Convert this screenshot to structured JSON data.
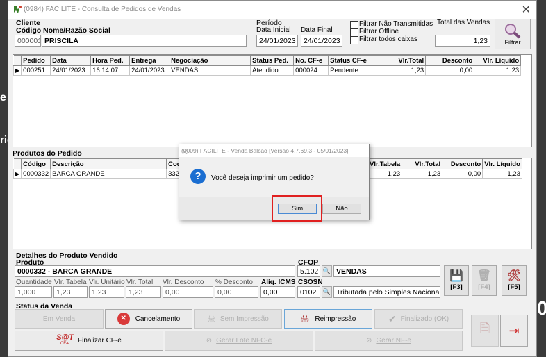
{
  "window": {
    "title": "(0984) FACILITE - Consulta de Pedidos de Vendas"
  },
  "background_fragments": [
    "e /",
    "ric",
    "0"
  ],
  "cliente": {
    "section_label": "Cliente",
    "codigo_label": "Código",
    "nome_label": "Nome/Razão Social",
    "codigo": "000001",
    "nome": "PRISCILA"
  },
  "periodo": {
    "section_label": "Período",
    "inicial_label": "Data Inicial",
    "final_label": "Data Final",
    "inicial": "24/01/2023",
    "final": "24/01/2023"
  },
  "filters": [
    {
      "label": "Filtrar Não Transmitidas",
      "checked": false
    },
    {
      "label": "Filtrar Offline",
      "checked": false
    },
    {
      "label": "Filtrar todos caixas",
      "checked": false
    }
  ],
  "total": {
    "label": "Total das Vendas",
    "value": "1,23"
  },
  "filtrar_button": {
    "label": "Filtrar",
    "icon": "magnifier-icon"
  },
  "orders": {
    "columns": [
      "Pedido",
      "Data",
      "Hora Ped.",
      "Entrega",
      "Negociação",
      "Status Ped.",
      "No. CF-e",
      "Status CF-e",
      "Vlr.Total",
      "Desconto",
      "Vlr. Líquido"
    ],
    "rows": [
      [
        "000251",
        "24/01/2023",
        "16:14:07",
        "24/01/2023",
        "VENDAS",
        "Atendido",
        "000024",
        "Pendente",
        "1,23",
        "0,00",
        "1,23"
      ]
    ]
  },
  "products": {
    "section_label": "Produtos do Pedido",
    "left_columns": [
      "Código",
      "Descrição",
      "Cod. E"
    ],
    "right_columns": [
      "Vlr.Tabela",
      "Vlr.Total",
      "Desconto",
      "Vlr. Líquido"
    ],
    "rows": [
      {
        "left": [
          "0000332",
          "BARCA GRANDE",
          "332"
        ],
        "right": [
          "1,23",
          "1,23",
          "0,00",
          "1,23"
        ]
      }
    ]
  },
  "detalhes": {
    "section_label": "Detalhes do Produto Vendido",
    "produto_label": "Produto",
    "produto": "0000332 - BARCA GRANDE",
    "cfop_label": "CFOP",
    "cfop": "5.102",
    "cfop_desc": "VENDAS",
    "csosn_label": "CSOSN",
    "csosn": "0102",
    "csosn_desc": "Tributada pelo Simples Nacional se",
    "quantidade_label": "Quantidade",
    "vlr_tabela_label": "Vlr. Tabela",
    "vlr_unitario_label": "Vlr. Unitário",
    "vlr_total_label": "Vlr. Total",
    "vlr_desconto_label": "Vlr. Desconto",
    "pct_desconto_label": "% Desconto",
    "aliq_icms_label": "Alíq. ICMS",
    "quantidade": "1,000",
    "vlr_tabela": "1,23",
    "vlr_unitario": "1,23",
    "vlr_total": "1,23",
    "vlr_desconto": "0,00",
    "pct_desconto": "0,00",
    "aliq_icms": "0,00"
  },
  "side_buttons": [
    {
      "label": "[F3]",
      "icon": "floppy-disk-icon",
      "enabled": true
    },
    {
      "label": "[F4]",
      "icon": "trash-icon",
      "enabled": false
    },
    {
      "label": "[F5]",
      "icon": "tools-icon",
      "enabled": true
    }
  ],
  "status": {
    "section_label": "Status da Venda",
    "em_venda": "Em Venda",
    "cancelamento": "Cancelamento",
    "sem_impressao": "Sem Impressão",
    "reimpressao": "Reimpressão",
    "finalizado": "Finalizado (OK)",
    "finalizar_cfe": "Finalizar CF-e",
    "finalizar_logo": "S@T",
    "finalizar_logo_sub": "CF-e",
    "gerar_lote": "Gerar Lote NFC-e",
    "gerar_nfe": "Gerar NF-e"
  },
  "dialog": {
    "title": "(0009) FACILITE - Venda Balcão [Versão 4.7.69.3 - 05/01/2023]",
    "message": "Você deseja imprimir um pedido?",
    "yes": "Sim",
    "no": "Não"
  },
  "colors": {
    "highlight": "#e02020",
    "cancel_icon": "#d93a3a",
    "question_icon": "#1b6ed1"
  }
}
